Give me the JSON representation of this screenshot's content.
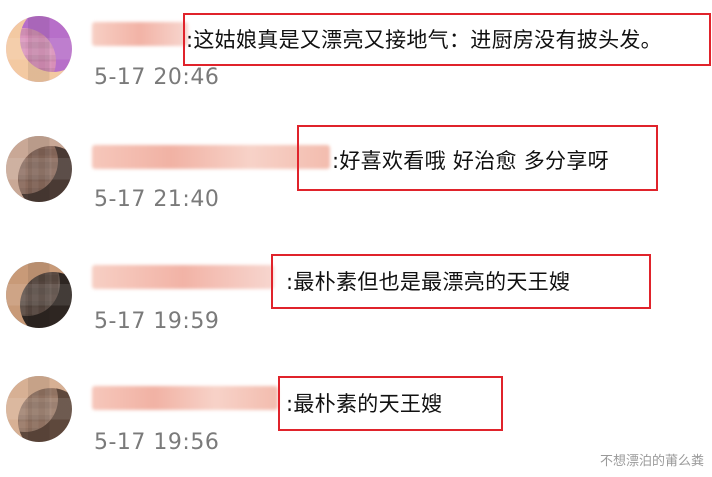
{
  "comments": [
    {
      "text": ":这姑娘真是又漂亮又接地气：进厨房没有披头发。",
      "time": "5-17 20:46"
    },
    {
      "text": ":好喜欢看哦 好治愈 多分享呀",
      "time": "5-17 21:40"
    },
    {
      "text": ":最朴素但也是最漂亮的天王嫂",
      "time": "5-17 19:59"
    },
    {
      "text": ":最朴素的天王嫂",
      "time": "5-17 19:56"
    }
  ],
  "watermark": "不想漂泊的莆么粪",
  "colors": {
    "highlight": "#e0232b",
    "timestamp": "#7a7a7a",
    "blurred_name": "#f2b3a6"
  }
}
